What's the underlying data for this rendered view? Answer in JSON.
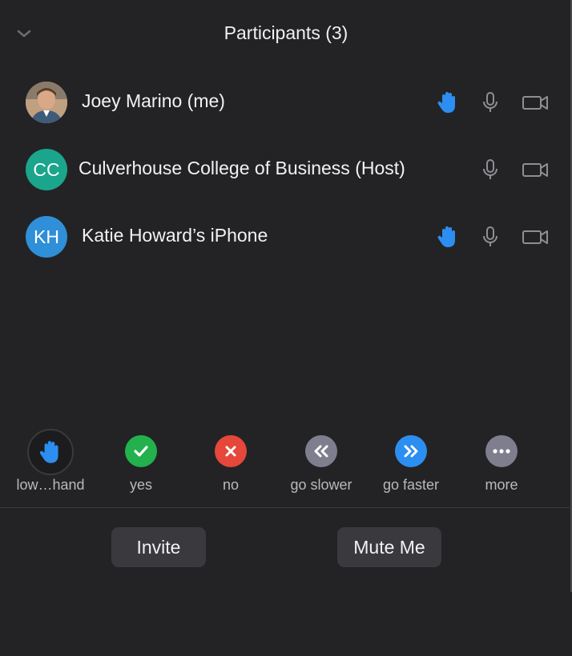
{
  "header": {
    "title": "Participants (3)"
  },
  "participants": [
    {
      "name": "Joey Marino (me)",
      "initials": "",
      "avatar": "photo",
      "hand_raised": true
    },
    {
      "name": "Culverhouse College of Business",
      "suffix": "(Host)",
      "initials": "CC",
      "avatar_color": "#1aa58c",
      "hand_raised": false
    },
    {
      "name": "Katie Howard’s iPhone",
      "initials": "KH",
      "avatar_color": "#2f8fd8",
      "hand_raised": true
    }
  ],
  "reactions": [
    {
      "label": "low…hand",
      "icon": "hand-icon"
    },
    {
      "label": "yes",
      "icon": "check-icon",
      "color": "#22b14c"
    },
    {
      "label": "no",
      "icon": "x-icon",
      "color": "#e5473b"
    },
    {
      "label": "go slower",
      "icon": "rewind-icon",
      "color": "#7f7e8e"
    },
    {
      "label": "go faster",
      "icon": "fast-forward-icon",
      "color": "#2c8ef0"
    },
    {
      "label": "more",
      "icon": "more-icon",
      "color": "#7f7e8e"
    }
  ],
  "buttons": {
    "invite": "Invite",
    "mute": "Mute Me"
  },
  "colors": {
    "background": "#232325",
    "accent_blue": "#2c8ef0",
    "icon_gray": "#8e8e93"
  }
}
